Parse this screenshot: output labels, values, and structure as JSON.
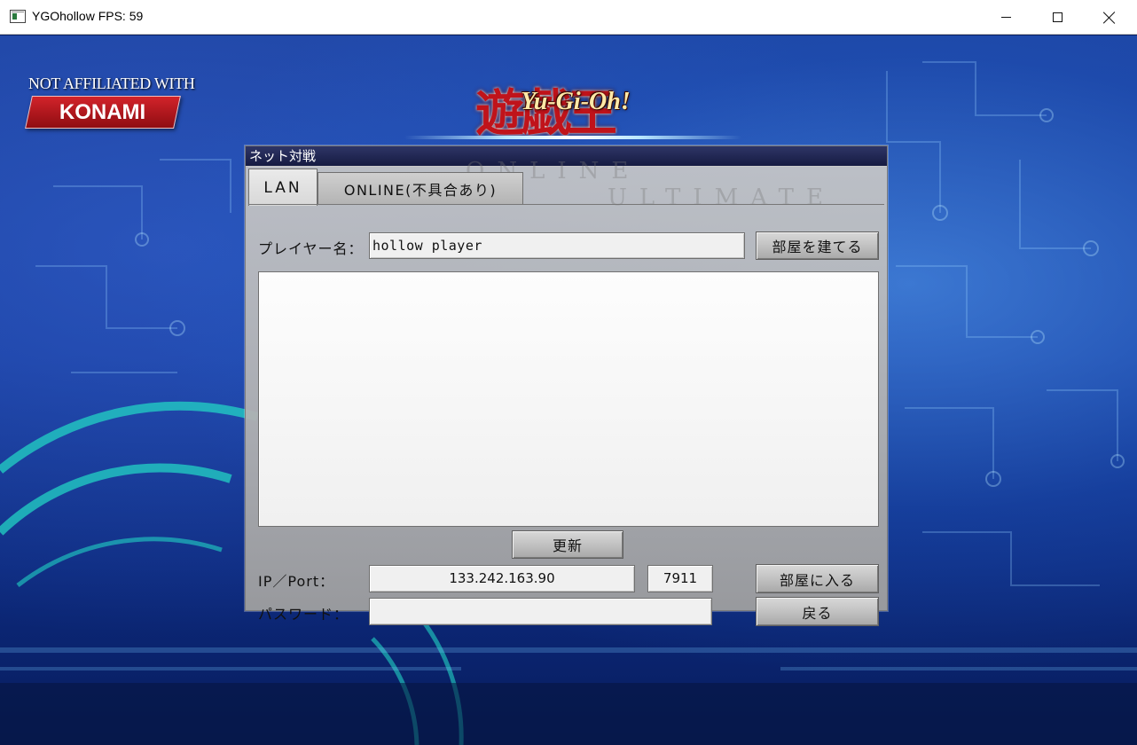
{
  "window": {
    "title": "YGOhollow FPS: 59",
    "controls": {
      "minimize_icon": "minimize-icon",
      "maximize_icon": "maximize-icon",
      "close_icon": "close-icon"
    }
  },
  "background": {
    "badge_line1": "NOT AFFILIATED WITH",
    "badge_line2": "KONAMI",
    "logo_glyphs": "遊戯王",
    "logo_text": "Yu-Gi-Oh!",
    "ghost_text_1": "ONLINE",
    "ghost_text_2": "ULTIMATE"
  },
  "dialog": {
    "title": "ネット対戦",
    "tabs": [
      {
        "label": "LAN",
        "active": true
      },
      {
        "label": "ONLINE(不具合あり)",
        "active": false
      }
    ],
    "player_label": "プレイヤー名：",
    "player_value": "hollow player",
    "host_button": "部屋を建てる",
    "refresh_button": "更新",
    "ip_label": "IP／Port：",
    "ip_value": "133.242.163.90",
    "port_value": "7911",
    "join_button": "部屋に入る",
    "password_label": "パスワード：",
    "password_value": "",
    "back_button": "戻る"
  },
  "colors": {
    "bg_blue": "#16399a",
    "circuit_cyan": "#22d3c5",
    "title_bar_navy": "#1f2550",
    "logo_red": "#c0131a",
    "konami_red": "#d2232a"
  }
}
